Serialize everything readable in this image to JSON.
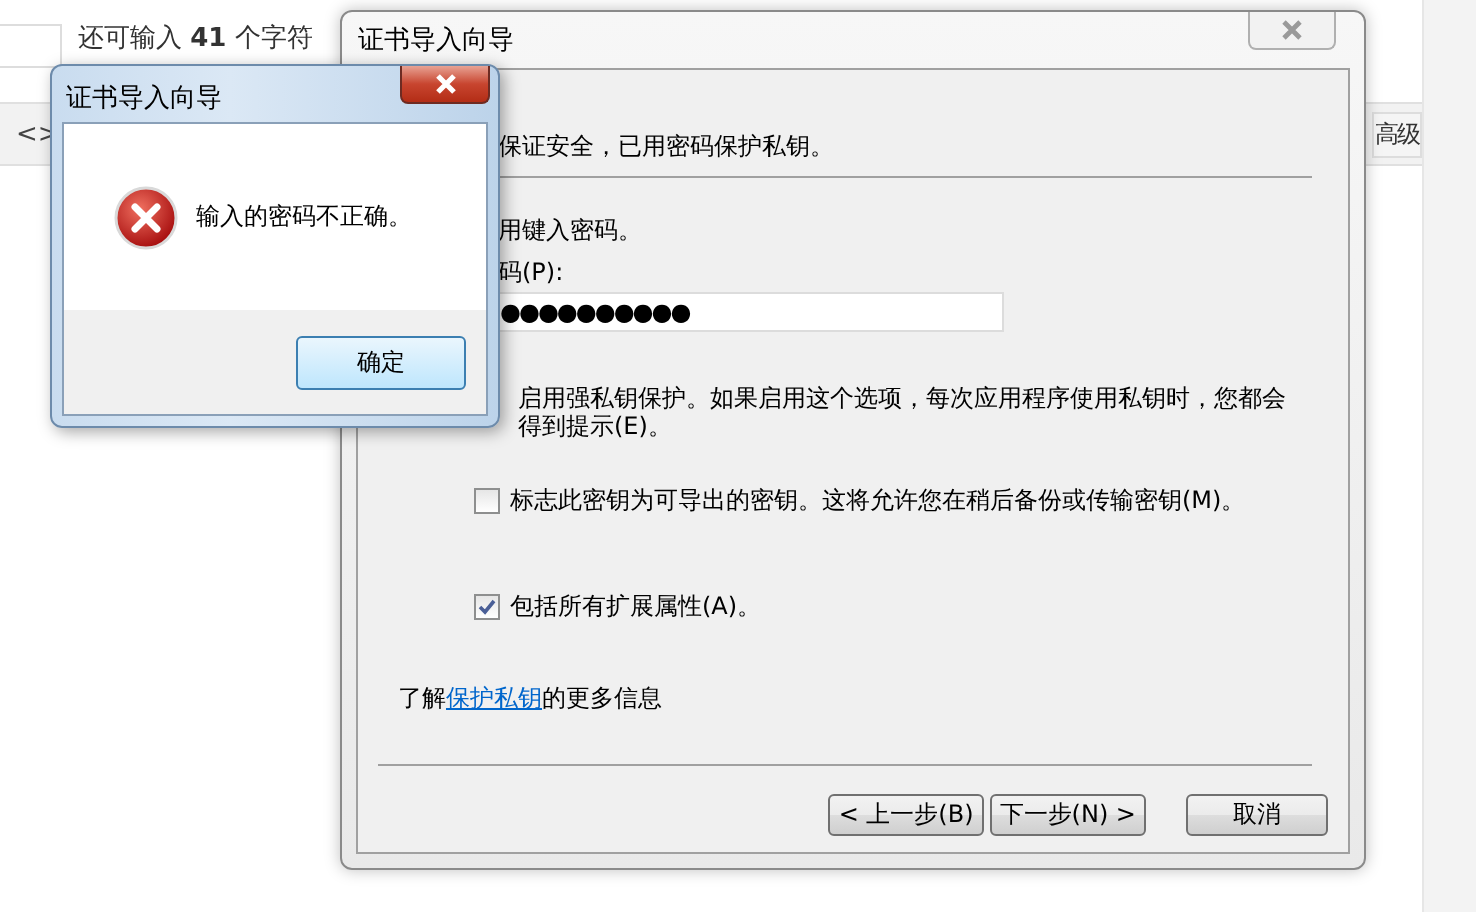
{
  "background_page": {
    "counter_text": "还可输入 **41** 个字符",
    "code_button": "<>",
    "advanced_button": "高级"
  },
  "wizard": {
    "title": "证书导入向导",
    "intro": "保证安全，已用密码保护私钥。",
    "prompt": "用键入密码。",
    "password_label": "码(P):",
    "password_value": "●●●●●●●●●●",
    "strong_protection_lines": [
      "启用强私钥保护。如果启用这个选项，每次应用程序使用私钥时，您都会",
      "得到提示(E)。"
    ],
    "options": [
      {
        "label": "标志此密钥为可导出的密钥。这将允许您在稍后备份或传输密钥(M)。",
        "checked": false
      },
      {
        "label": "包括所有扩展属性(A)。",
        "checked": true
      }
    ],
    "learn_more": {
      "before": "了解",
      "link": "保护私钥",
      "after": "的更多信息"
    },
    "buttons": [
      {
        "label": "< 上一步(B)"
      },
      {
        "label": "下一步(N) >"
      },
      {
        "label": "取消"
      }
    ]
  },
  "error_dialog": {
    "title": "证书导入向导",
    "message": "输入的密码不正确。",
    "ok_button": "确定"
  }
}
